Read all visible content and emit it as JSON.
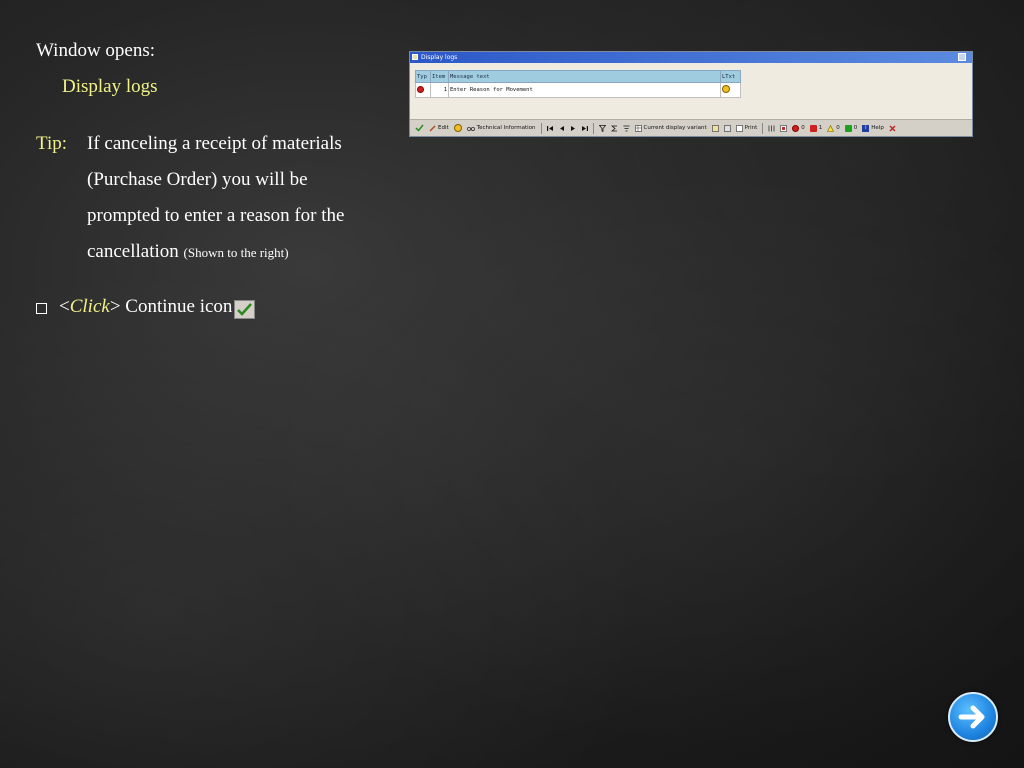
{
  "slide": {
    "window_opens": "Window opens:",
    "display_logs": "Display logs",
    "tip_label": "Tip:",
    "tip_lines": [
      "If canceling a receipt of materials",
      "(Purchase Order) you will be",
      "prompted to enter a reason for the",
      "cancellation"
    ],
    "tip_note": "(Shown to the right)",
    "instruction": {
      "open": "<",
      "click": "Click",
      "close": ">",
      "text": " Continue icon"
    }
  },
  "sap_window": {
    "title": "Display logs",
    "columns": [
      "Typ",
      "Item",
      "Message text",
      "LTxt"
    ],
    "rows": [
      {
        "typ_icon": "stop-icon",
        "item": "1",
        "message": "Enter Reason for Movement",
        "ltxt_icon": "longtext-icon"
      }
    ],
    "toolbar": {
      "edit": "Edit",
      "technical_info": "Technical Information",
      "current_display_variant": "Current display variant",
      "print": "Print",
      "count_stop": "0",
      "count_error": "1",
      "count_warning": "0",
      "count_success": "0",
      "help": "Help"
    }
  },
  "colors": {
    "highlight_yellow": "#f2f28a",
    "sap_header_blue": "#a0cce0",
    "title_bar_blue": "#2c58c8"
  }
}
